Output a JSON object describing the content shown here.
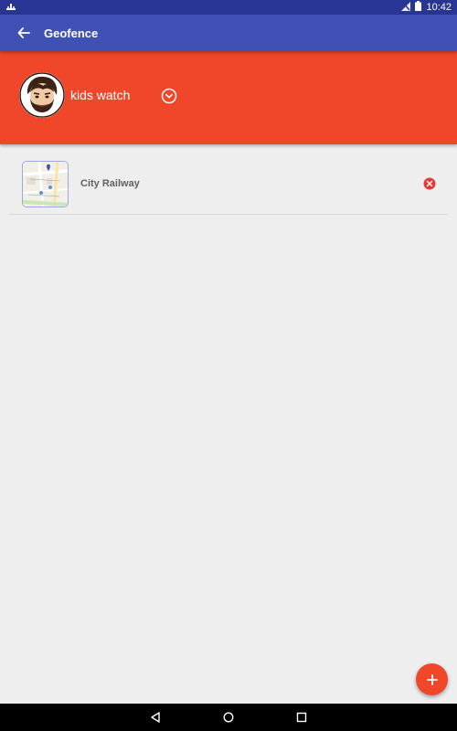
{
  "status_bar": {
    "time": "10:42",
    "icons": [
      "notification-icon",
      "no-sim-icon",
      "battery-icon"
    ]
  },
  "app_bar": {
    "title": "Geofence",
    "back_icon": "arrow-back-icon"
  },
  "profile": {
    "device_name": "kids watch",
    "avatar_icon": "cartoon-man-avatar",
    "dropdown_icon": "chevron-down-circle-icon"
  },
  "geofences": [
    {
      "name": "City Railway",
      "thumbnail_icon": "map-thumbnail",
      "remove_icon": "remove-circle-icon"
    }
  ],
  "fab": {
    "icon": "plus-icon"
  },
  "nav_bar": {
    "icons": [
      "back-triangle-icon",
      "home-circle-icon",
      "recents-square-icon"
    ]
  },
  "colors": {
    "status_bar": "#283593",
    "app_bar": "#3f51b5",
    "accent": "#f04629",
    "background": "#eeeeee"
  }
}
